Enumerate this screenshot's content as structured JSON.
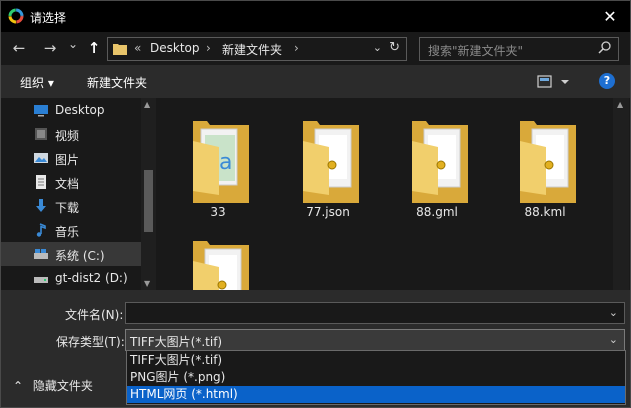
{
  "window": {
    "title": "请选择"
  },
  "nav": {
    "back": "←",
    "forward": "→",
    "recent": "⌄",
    "up": "↑",
    "breadcrumb_prefix": "«",
    "crumbs": [
      "Desktop",
      "新建文件夹"
    ],
    "search_placeholder": "搜索\"新建文件夹\""
  },
  "toolbar": {
    "organize": "组织 ▾",
    "new_folder": "新建文件夹",
    "help": "?"
  },
  "sidebar": {
    "items": [
      {
        "label": "Desktop",
        "icon": "desktop-icon"
      },
      {
        "label": "视频",
        "icon": "video-icon"
      },
      {
        "label": "图片",
        "icon": "pictures-icon"
      },
      {
        "label": "文档",
        "icon": "documents-icon"
      },
      {
        "label": "下载",
        "icon": "downloads-icon"
      },
      {
        "label": "音乐",
        "icon": "music-icon"
      },
      {
        "label": "系统 (C:)",
        "icon": "drive-icon"
      },
      {
        "label": "gt-dist2 (D:)",
        "icon": "drive-icon"
      }
    ]
  },
  "files": [
    {
      "name": "33"
    },
    {
      "name": "77.json"
    },
    {
      "name": "88.gml"
    },
    {
      "name": "88.kml"
    },
    {
      "name": ""
    }
  ],
  "form": {
    "filename_label": "文件名(N):",
    "filename_value": "",
    "type_label": "保存类型(T):",
    "type_value": "TIFF大图片(*.tif)",
    "options": [
      "TIFF大图片(*.tif)",
      "PNG图片 (*.png)",
      "HTML网页 (*.html)"
    ],
    "hide_folders": "隐藏文件夹"
  },
  "colors": {
    "selection": "#0a62c9",
    "background": "#191919",
    "toolbar": "#2b2b2b"
  }
}
